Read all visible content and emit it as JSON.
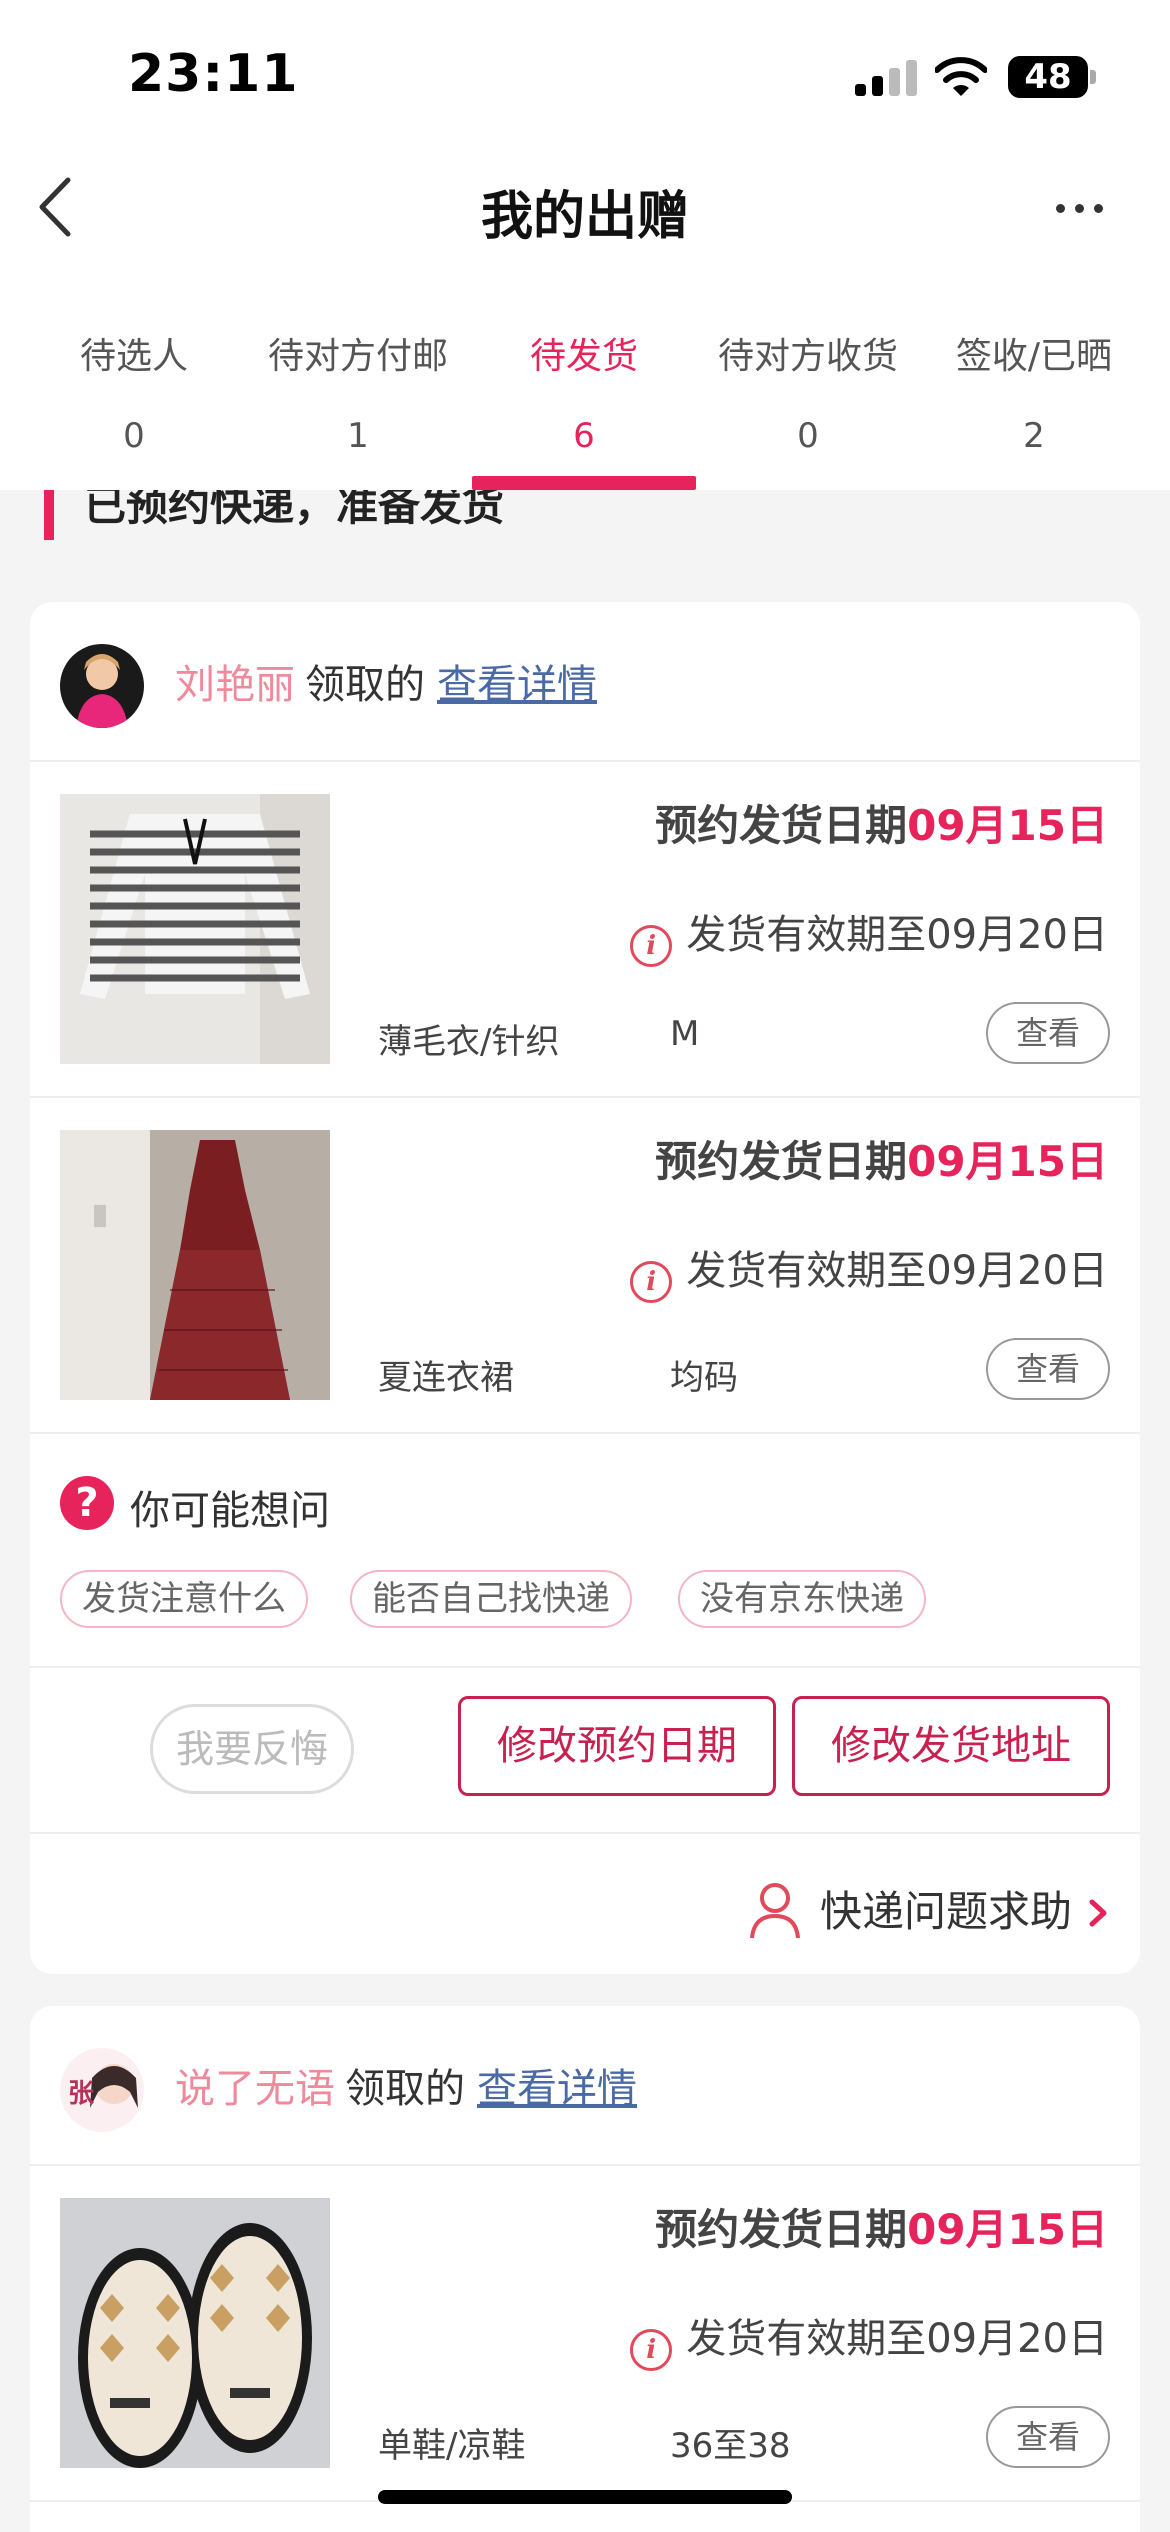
{
  "status_bar": {
    "time": "23:11",
    "battery": "48"
  },
  "nav": {
    "title": "我的出赠"
  },
  "tabs": [
    {
      "label": "待选人",
      "count": "0"
    },
    {
      "label": "待对方付邮",
      "count": "1"
    },
    {
      "label": "待发货",
      "count": "6",
      "active": true
    },
    {
      "label": "待对方收货",
      "count": "0"
    },
    {
      "label": "签收/已晒",
      "count": "2"
    }
  ],
  "section": {
    "title": "已预约快递，准备发货"
  },
  "cards": [
    {
      "receiver": "刘艳丽",
      "claimed": "领取的",
      "detail_link": "查看详情",
      "items": [
        {
          "ship_label": "预约发货日期",
          "ship_date": "09月15日",
          "valid": "发货有效期至09月20日",
          "category": "薄毛衣/针织",
          "size": "M",
          "view": "查看"
        },
        {
          "ship_label": "预约发货日期",
          "ship_date": "09月15日",
          "valid": "发货有效期至09月20日",
          "category": "夏连衣裙",
          "size": "均码",
          "view": "查看"
        }
      ],
      "faq": {
        "title": "你可能想问",
        "chips": [
          "发货注意什么",
          "能否自己找快递",
          "没有京东快递"
        ]
      },
      "actions": {
        "regret": "我要反悔",
        "modify_date": "修改预约日期",
        "modify_address": "修改发货地址"
      },
      "help": "快递问题求助"
    },
    {
      "receiver": "说了无语",
      "claimed": "领取的",
      "detail_link": "查看详情",
      "items": [
        {
          "ship_label": "预约发货日期",
          "ship_date": "09月15日",
          "valid": "发货有效期至09月20日",
          "category": "单鞋/凉鞋",
          "size": "36至38",
          "view": "查看"
        }
      ]
    }
  ],
  "colors": {
    "accent": "#e6235b",
    "button_border": "#c8204f",
    "receiver_name": "#ef8a9c",
    "link": "#4a6aa5"
  }
}
